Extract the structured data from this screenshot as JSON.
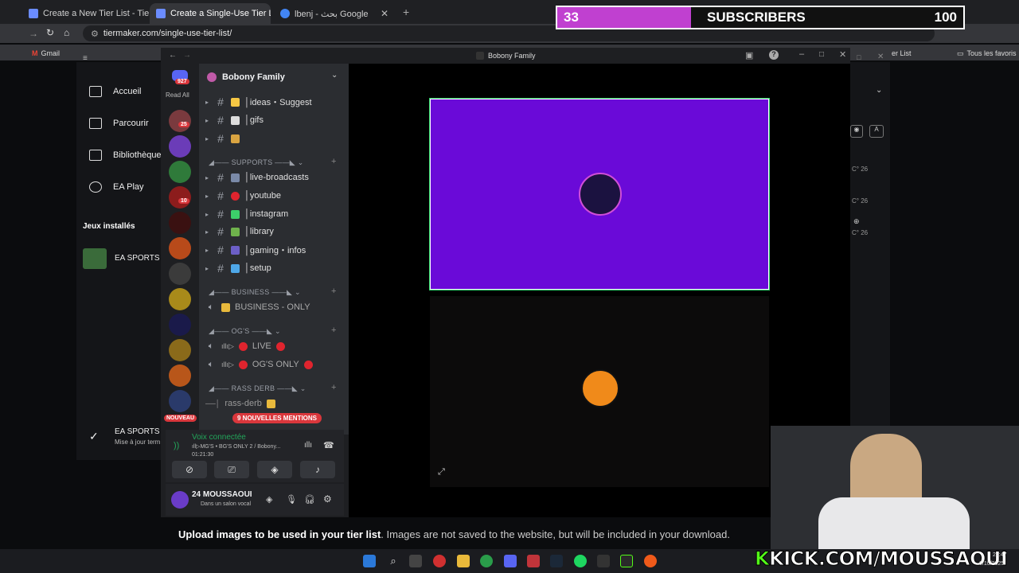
{
  "browser": {
    "tabs": [
      {
        "title": "Create a New Tier List - TierMa"
      },
      {
        "title": "Create a Single-Use Tier List (P"
      },
      {
        "title": "lbenj - بحث Google"
      }
    ],
    "url": "tiermaker.com/single-use-tier-list/",
    "bookmarks": {
      "gmail": "Gmail",
      "all_favorites": "Tous les favoris",
      "tier_list": "er List"
    }
  },
  "overlay": {
    "count": "33",
    "label": "SUBSCRIBERS",
    "goal": "100",
    "progress_fraction": 0.33
  },
  "ea_app": {
    "nav": [
      {
        "label": "Accueil",
        "icon": "home-icon"
      },
      {
        "label": "Parcourir",
        "icon": "grid-icon"
      },
      {
        "label": "Bibliothèque",
        "icon": "library-icon"
      },
      {
        "label": "EA Play",
        "icon": "ea-play-icon"
      }
    ],
    "installed_heading": "Jeux installés",
    "installed_game": "EA SPORTS F",
    "update": {
      "title": "EA SPORTS F",
      "subtitle": "Mise à jour term"
    }
  },
  "discord": {
    "window_title": "Bobony Family",
    "read_all": "Read All",
    "dm_badge": "927",
    "server_name": "Bobony Family",
    "server_badges": [
      "25",
      "10"
    ],
    "new_label": "NOUVEAU",
    "mentions_pill": "9 NOUVELLES MENTIONS",
    "channels_top": [
      {
        "name": "│ideas・Suggest",
        "emoji_color": "#f6c744"
      },
      {
        "name": "│gifs",
        "emoji_color": "#dddddd"
      },
      {
        "name": "",
        "emoji_color": "#d9a441"
      }
    ],
    "categories": [
      {
        "name": "SUPPORTS",
        "channels": [
          {
            "name": "│live-broadcasts",
            "emoji_color": "#7a8aa8"
          },
          {
            "name": "│youtube",
            "emoji_color": "#e0242e"
          },
          {
            "name": "│instagram",
            "emoji_color": "#3ccf6a"
          },
          {
            "name": "│library",
            "emoji_color": "#6fb24c"
          },
          {
            "name": "│gaming・infos",
            "emoji_color": "#6c5fc7"
          },
          {
            "name": "│setup",
            "emoji_color": "#4ea7e8"
          }
        ]
      },
      {
        "name": "BUSINESS",
        "channels": [
          {
            "name": "BUSINESS - ONLY",
            "voice": true
          }
        ]
      },
      {
        "name": "OG'S",
        "channels": [
          {
            "name": "LIVE",
            "voice": true
          },
          {
            "name": "OG'S ONLY",
            "voice": true
          }
        ]
      },
      {
        "name": "RASS DERB",
        "channels": [
          {
            "name": "rass-derb",
            "voice": false
          }
        ]
      }
    ],
    "voice": {
      "status": "Voix connectée",
      "channel": "ıll▷MG'S • BG'S ONLY 2 / Bobony...",
      "timer": "01:21:30"
    },
    "user": {
      "name": "24 MOUSSAOUI",
      "status": "Dans un salon vocal"
    }
  },
  "tiermaker": {
    "upload_bold": "Upload images to be used in your tier list",
    "upload_rest": ". Images are not saved to the website, but will be included in your download.",
    "side_labels": [
      "C° 26",
      "C° 26",
      "C° 26"
    ]
  },
  "stream": {
    "kick_prefix": "K",
    "kick_text": "KICK.COM/MOUSSAOUI"
  },
  "taskbar": {
    "time": "21:47",
    "date": "0/10/2025"
  },
  "colors": {
    "accent_purple": "#6a0ad8",
    "kick_green": "#53fc18",
    "discord_bg": "#2b2d31"
  }
}
